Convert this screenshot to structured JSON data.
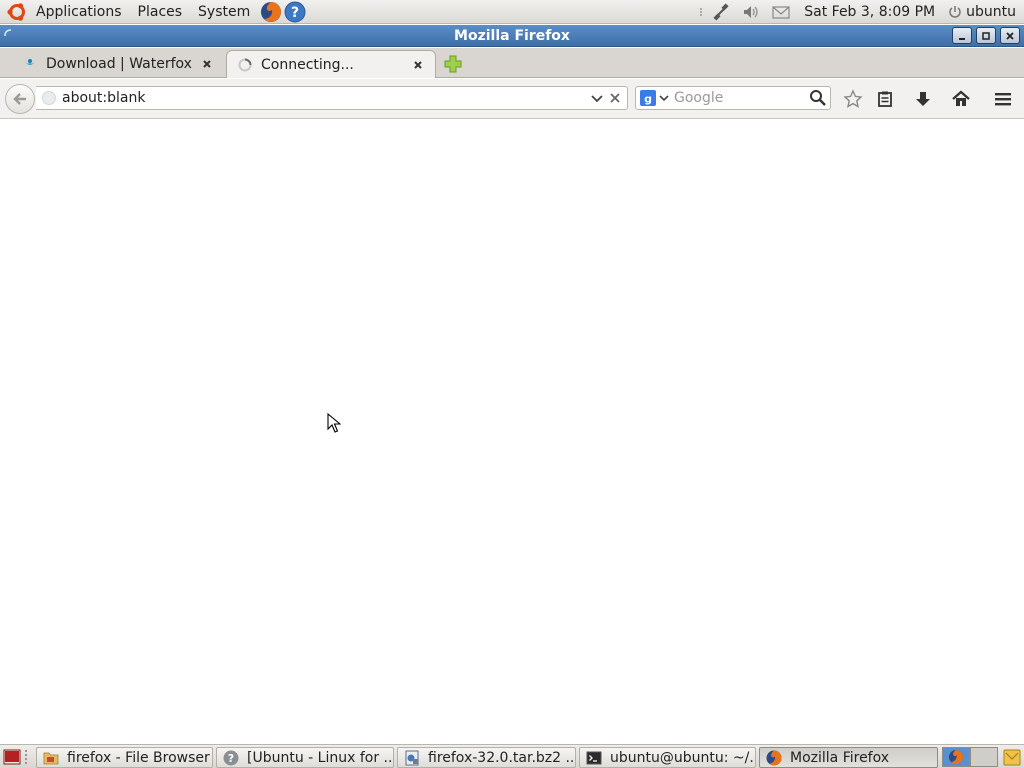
{
  "top_panel": {
    "menus": [
      "Applications",
      "Places",
      "System"
    ],
    "clock": "Sat Feb  3,  8:09 PM",
    "user": "ubuntu"
  },
  "window": {
    "title": "Mozilla Firefox"
  },
  "tabs": [
    {
      "label": "Download | Waterfox",
      "active": false
    },
    {
      "label": "Connecting...",
      "active": true
    }
  ],
  "navbar": {
    "url": "about:blank",
    "search_placeholder": "Google"
  },
  "taskbar": {
    "items": [
      {
        "label": "firefox - File Browser",
        "icon": "folder-icon",
        "active": false
      },
      {
        "label": "[Ubuntu - Linux for ...",
        "icon": "help-icon",
        "active": false
      },
      {
        "label": "firefox-32.0.tar.bz2 ...",
        "icon": "archive-icon",
        "active": false
      },
      {
        "label": "ubuntu@ubuntu: ~/...",
        "icon": "terminal-icon",
        "active": false
      },
      {
        "label": "Mozilla Firefox",
        "icon": "firefox-icon",
        "active": true
      }
    ]
  },
  "colors": {
    "titlebar": "#4a7bb7",
    "panel": "#e6e4e0",
    "accent_orange": "#dd4814"
  }
}
